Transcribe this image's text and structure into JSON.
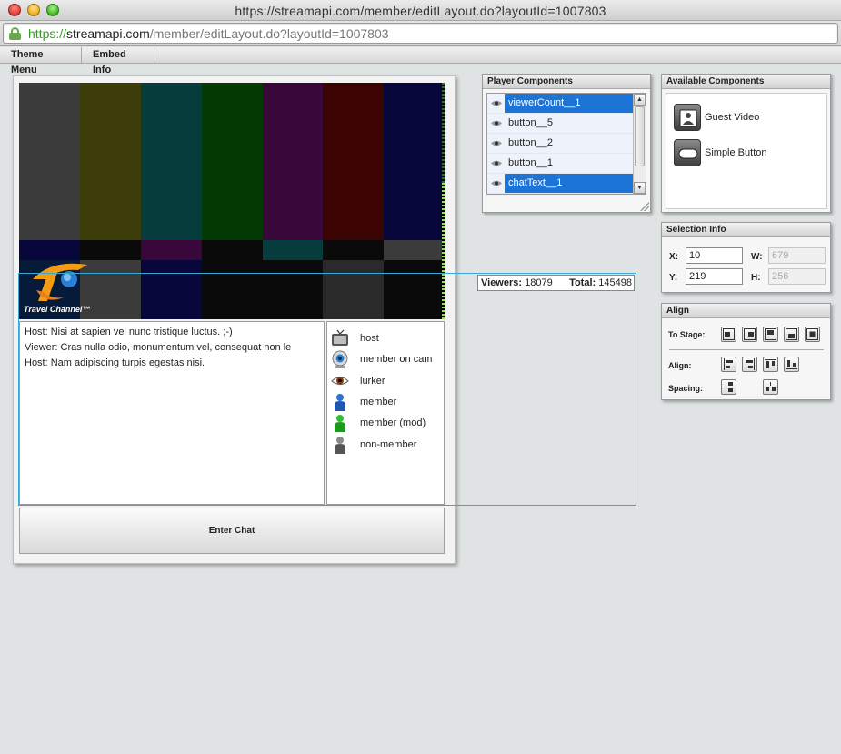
{
  "window": {
    "title": "https://streamapi.com/member/editLayout.do?layoutId=1007803"
  },
  "address_bar": {
    "scheme": "https://",
    "host": "streamapi.com",
    "path": "/member/editLayout.do?layoutId=1007803"
  },
  "menu": {
    "items": [
      "Theme Menu",
      "Embed Info"
    ]
  },
  "stage": {
    "video": {
      "logo_text": "Travel Channel™",
      "test_pattern_top": [
        "#3b3b3b",
        "#3d3d0a",
        "#073c3c",
        "#033a03",
        "#3a073a",
        "#3c0303",
        "#07073c"
      ],
      "test_pattern_mid": [
        "#07073c",
        "#0a0a0a",
        "#3a073a",
        "#0a0a0a",
        "#073c3c",
        "#0a0a0a",
        "#3b3b3b"
      ],
      "test_pattern_bottom": [
        "#061a3a",
        "#3b3b3b",
        "#07073c",
        "#0a0a0a",
        "#0a0a0a",
        "#2a2a2a",
        "#0a0a0a"
      ]
    },
    "chat_lines": [
      "Host: Nisi at sapien vel nunc tristique luctus. ;-)",
      "Viewer: Cras nulla odio, monumentum vel, consequat non le",
      "Host: Nam adipiscing turpis egestas nisi."
    ],
    "user_types": [
      {
        "label": "host",
        "icon": "tv-icon"
      },
      {
        "label": "member on cam",
        "icon": "webcam-icon"
      },
      {
        "label": "lurker",
        "icon": "eye-icon"
      },
      {
        "label": "member",
        "icon": "blue-user-icon"
      },
      {
        "label": "member (mod)",
        "icon": "green-user-icon"
      },
      {
        "label": "non-member",
        "icon": "gray-user-icon"
      }
    ],
    "enter_chat_label": "Enter Chat",
    "viewer_count": {
      "viewers_label": "Viewers:",
      "viewers_value": "18079",
      "total_label": "Total:",
      "total_value": "145498"
    }
  },
  "player_components": {
    "title": "Player Components",
    "items": [
      {
        "label": "viewerCount__1",
        "selected": true
      },
      {
        "label": "button__5",
        "selected": false
      },
      {
        "label": "button__2",
        "selected": false
      },
      {
        "label": "button__1",
        "selected": false
      },
      {
        "label": "chatText__1",
        "selected": true
      }
    ],
    "scroll_up": "▲",
    "scroll_down": "▼"
  },
  "available_components": {
    "title": "Available Components",
    "items": [
      {
        "label": "Guest Video",
        "icon": "guest-video-icon"
      },
      {
        "label": "Simple Button",
        "icon": "simple-button-icon"
      }
    ]
  },
  "selection_info": {
    "title": "Selection Info",
    "x_label": "X:",
    "x_value": "10",
    "y_label": "Y:",
    "y_value": "219",
    "w_label": "W:",
    "w_value": "679",
    "h_label": "H:",
    "h_value": "256"
  },
  "align": {
    "title": "Align",
    "to_stage_label": "To Stage:",
    "align_label": "Align:",
    "spacing_label": "Spacing:"
  },
  "colors": {
    "selection_blue": "#1c74d6",
    "outline_cyan": "#3aa6d6",
    "logo_orange": "#f39c12"
  }
}
